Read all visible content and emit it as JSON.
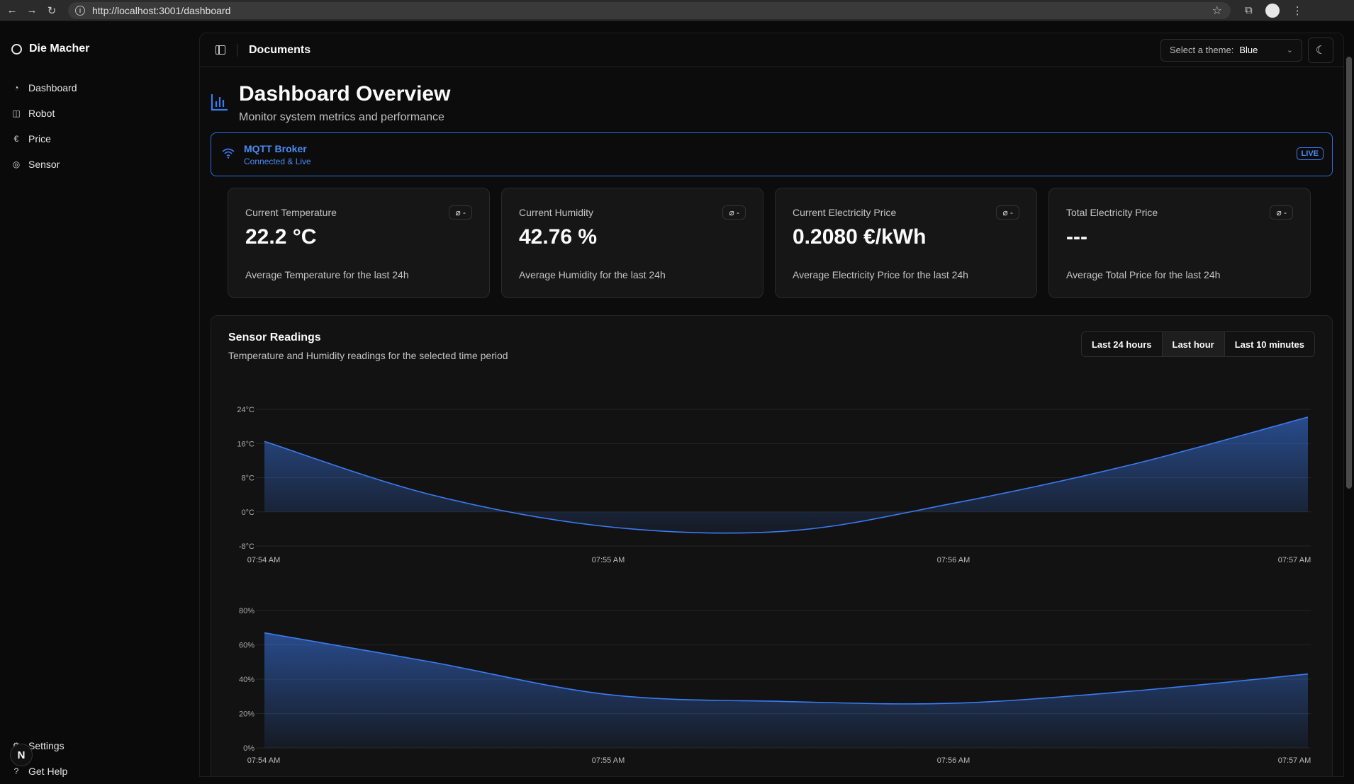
{
  "browser": {
    "url": "http://localhost:3001/dashboard"
  },
  "sidebar": {
    "brand": "Die Macher",
    "items": [
      {
        "label": "Dashboard",
        "icon": "gauge-icon"
      },
      {
        "label": "Robot",
        "icon": "robot-icon"
      },
      {
        "label": "Price",
        "icon": "euro-icon"
      },
      {
        "label": "Sensor",
        "icon": "sensor-icon"
      }
    ],
    "bottom": [
      {
        "label": "Settings",
        "icon": "gear-icon"
      },
      {
        "label": "Get Help",
        "icon": "help-icon"
      }
    ],
    "avatar_letter": "N"
  },
  "topbar": {
    "title": "Documents",
    "theme_label": "Select a theme:",
    "theme_value": "Blue"
  },
  "header": {
    "title": "Dashboard Overview",
    "subtitle": "Monitor system metrics and performance"
  },
  "mqtt": {
    "name": "MQTT Broker",
    "status": "Connected & Live",
    "badge": "LIVE"
  },
  "cards": [
    {
      "label": "Current Temperature",
      "value": "22.2 °C",
      "foot": "Average Temperature for the last 24h",
      "badge": "⌀ -"
    },
    {
      "label": "Current Humidity",
      "value": "42.76 %",
      "foot": "Average Humidity for the last 24h",
      "badge": "⌀ -"
    },
    {
      "label": "Current Electricity Price",
      "value": "0.2080 €/kWh",
      "foot": "Average Electricity Price for the last 24h",
      "badge": "⌀ -"
    },
    {
      "label": "Total Electricity Price",
      "value": "---",
      "foot": "Average Total Price for the last 24h",
      "badge": "⌀ -"
    }
  ],
  "sensor": {
    "title": "Sensor Readings",
    "subtitle": "Temperature and Humidity readings for the selected time period",
    "ranges": [
      "Last 24 hours",
      "Last hour",
      "Last 10 minutes"
    ],
    "active_range": "Last hour"
  },
  "colors": {
    "accent": "#3b7bf0",
    "background": "#0a0a0a"
  },
  "chart_data": [
    {
      "type": "area",
      "x": [
        "07:54 AM",
        "07:55 AM",
        "07:56 AM",
        "07:57 AM"
      ],
      "yticks": [
        "24°C",
        "16°C",
        "8°C",
        "0°C",
        "-8°C"
      ],
      "ylim": [
        -8,
        24
      ],
      "points_x": [
        0,
        0.16,
        0.33,
        0.5,
        0.66,
        0.83,
        1.0
      ],
      "points_y": [
        16.5,
        4,
        -3.5,
        -4.5,
        2,
        11,
        22.2
      ]
    },
    {
      "type": "area",
      "x": [
        "07:54 AM",
        "07:55 AM",
        "07:56 AM",
        "07:57 AM"
      ],
      "yticks": [
        "80%",
        "60%",
        "40%",
        "20%",
        "0%"
      ],
      "ylim": [
        0,
        80
      ],
      "points_x": [
        0,
        0.16,
        0.33,
        0.5,
        0.66,
        0.83,
        1.0
      ],
      "points_y": [
        67,
        50,
        31,
        27,
        26,
        33,
        43
      ]
    }
  ]
}
